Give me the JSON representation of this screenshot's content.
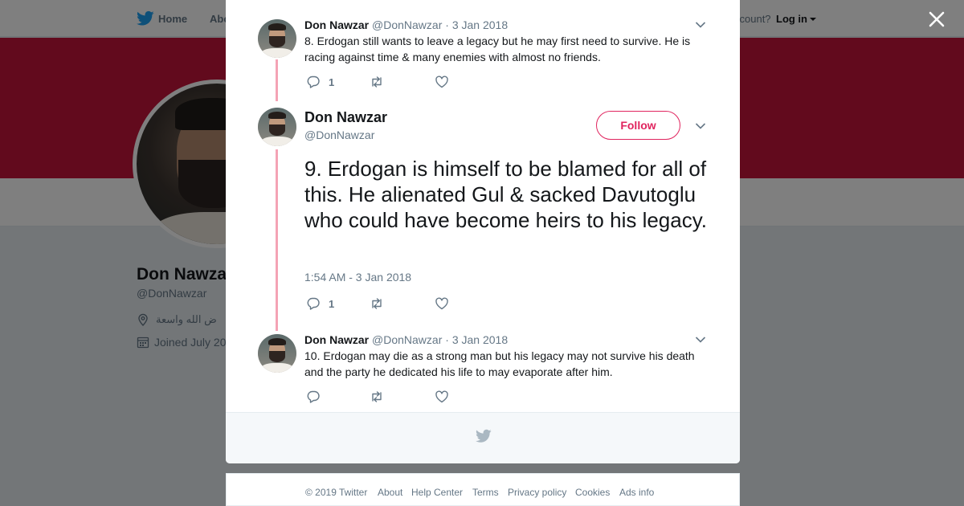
{
  "background": {
    "nav": {
      "home": "Home",
      "about": "Abo",
      "account_prompt": "ccount?",
      "login": "Log in"
    },
    "profile": {
      "name": "Don Nawza",
      "handle": "@DonNawzar",
      "location": "ض الله واسعة",
      "joined": "Joined July 20"
    }
  },
  "tweets": [
    {
      "name": "Don Nawzar",
      "handle": "@DonNawzar",
      "date": "· 3 Jan 2018",
      "text": "8. Erdogan still wants to leave a legacy but he may first need to survive. He is racing against time & many enemies with almost no friends.",
      "reply_count": "1"
    },
    {
      "name": "Don Nawzar",
      "handle": "@DonNawzar",
      "follow_label": "Follow",
      "text": "9. Erdogan is himself to be blamed for all of this. He alienated Gul & sacked Davutoglu who could have become heirs to his legacy.",
      "timestamp": "1:54 AM - 3 Jan 2018",
      "reply_count": "1"
    },
    {
      "name": "Don Nawzar",
      "handle": "@DonNawzar",
      "date": "· 3 Jan 2018",
      "text": "10. Erdogan may die as a strong man but his legacy may not survive his death and the party he dedicated his life to may evaporate after him."
    }
  ],
  "footer": {
    "copyright": "© 2019 Twitter",
    "links": [
      "About",
      "Help Center",
      "Terms",
      "Privacy policy",
      "Cookies",
      "Ads info"
    ]
  },
  "colors": {
    "accent": "#e0245e",
    "banner": "#c4143a",
    "thread_line": "#f4a3b5",
    "brand": "#1da1f2"
  },
  "icons": [
    "twitter-bird-icon",
    "close-icon",
    "chevron-down-icon",
    "reply-icon",
    "retweet-icon",
    "like-icon",
    "location-pin-icon",
    "calendar-icon"
  ]
}
